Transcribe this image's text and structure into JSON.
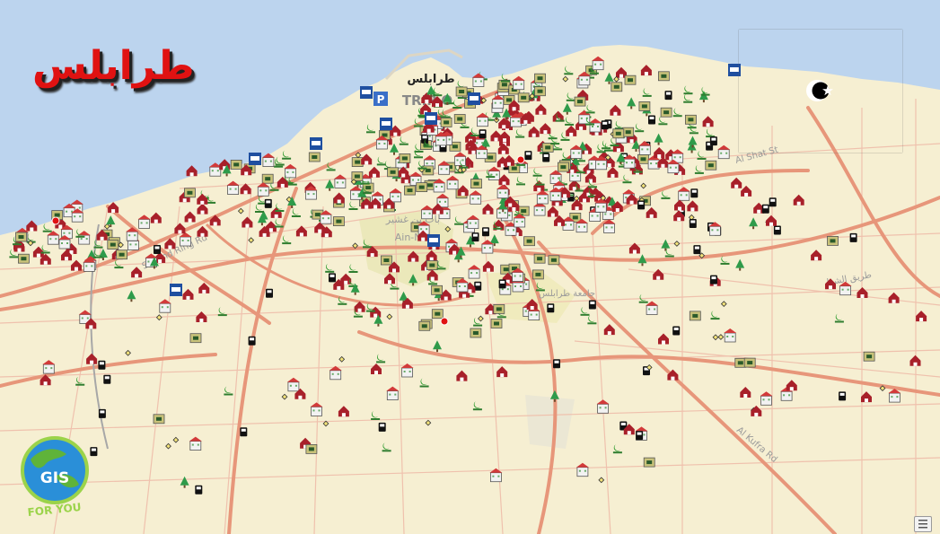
{
  "title": "طرابلس",
  "map_labels": {
    "city_ar": "طرابلس",
    "city_en": "TRIP O",
    "district_ar": "باب بن غشير",
    "district_en": "Ain-No",
    "ring_road": "Second Ring Rd",
    "coast_road": "Al Shat St",
    "university": "جامعة طرابلس",
    "east_road_ar": "طريق الشط",
    "south_road": "Al Kufra Rd"
  },
  "flag": {
    "country": "Libya",
    "colors": {
      "red": "#e70013",
      "black": "#000000",
      "green": "#239e46"
    }
  },
  "logo": {
    "line1": "GIS",
    "line2": "FOR YOU"
  },
  "colors": {
    "sea": "#bcd4ee",
    "land": "#f6efd2",
    "road_major": "#e7967a",
    "road_minor": "#efc1ad",
    "title_red": "#e01212"
  },
  "poi_types": [
    "mosque-icon",
    "house-icon",
    "school-icon",
    "fuel-icon",
    "bus-icon",
    "parking-icon",
    "park-tree-icon",
    "hospital-icon"
  ]
}
